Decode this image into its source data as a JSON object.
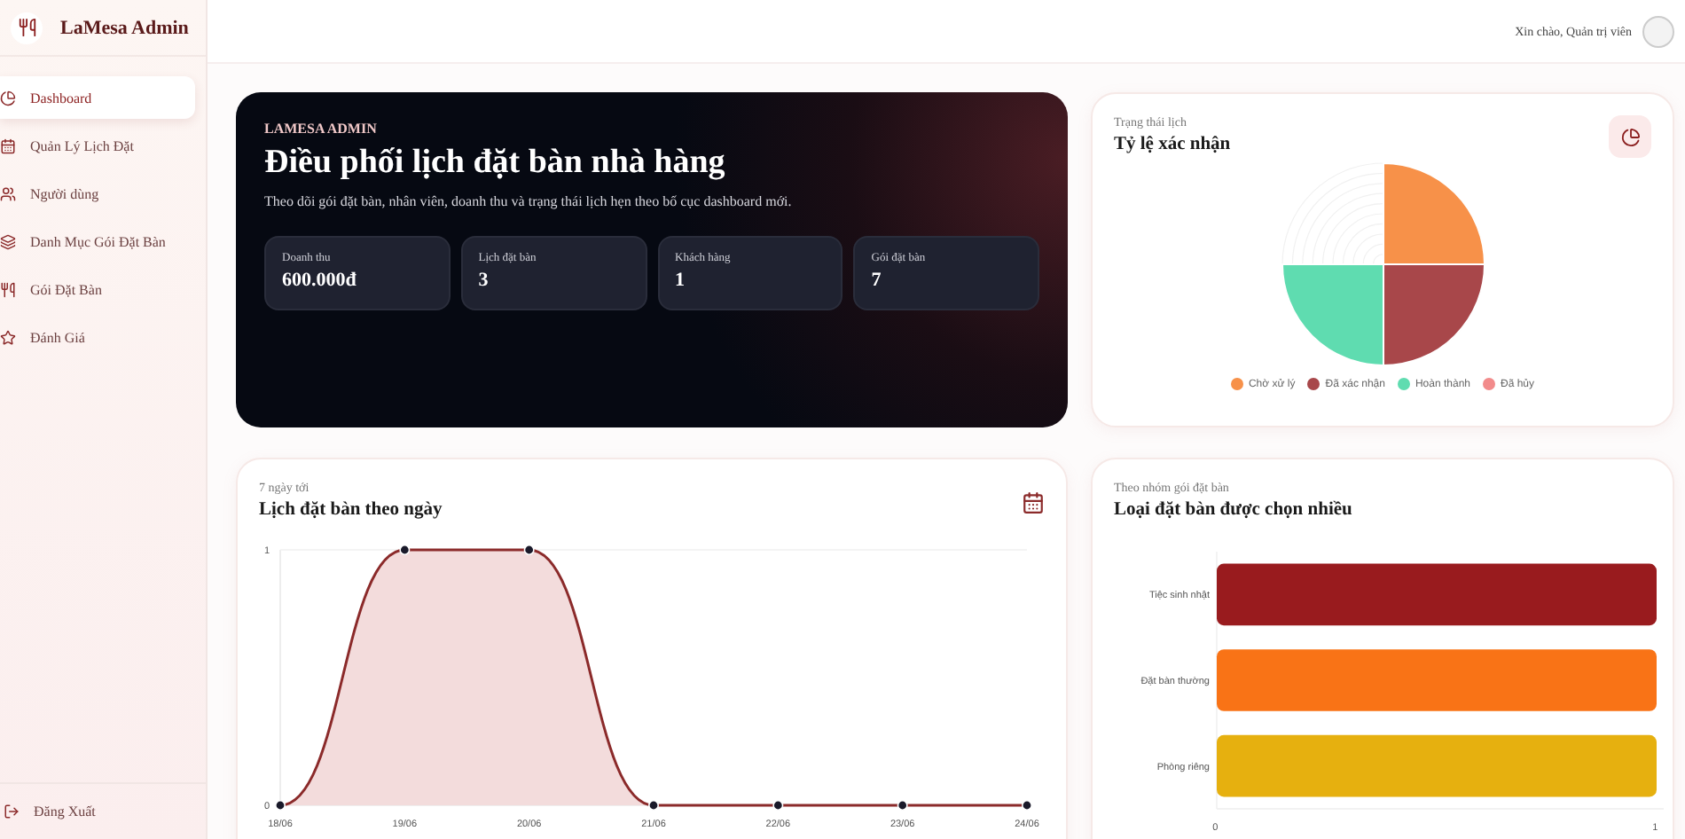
{
  "sidebar": {
    "brand": "LaMesa Admin",
    "items": [
      {
        "label": "Dashboard",
        "selected": true
      },
      {
        "label": "Quản Lý Lịch Đặt",
        "selected": false
      },
      {
        "label": "Người dùng",
        "selected": false
      },
      {
        "label": "Danh Mục Gói Đặt Bàn",
        "selected": false
      },
      {
        "label": "Gói Đặt Bàn",
        "selected": false
      },
      {
        "label": "Đánh Giá",
        "selected": false
      }
    ],
    "logout": "Đăng Xuất"
  },
  "topbar": {
    "greeting": "Xin chào, Quản trị viên"
  },
  "hero": {
    "eyebrow": "LAMESA ADMIN",
    "title": "Điều phối lịch đặt bàn nhà hàng",
    "subtitle": "Theo dõi gói đặt bàn, nhân viên, doanh thu và trạng thái lịch hẹn theo bố cục dashboard mới.",
    "stats": [
      {
        "label": "Doanh thu",
        "value": "600.000đ"
      },
      {
        "label": "Lịch đặt bàn",
        "value": "3"
      },
      {
        "label": "Khách hàng",
        "value": "1"
      },
      {
        "label": "Gói đặt bàn",
        "value": "7"
      }
    ]
  },
  "status_card": {
    "eyebrow": "Trạng thái lịch",
    "title": "Tỷ lệ xác nhận",
    "legend": [
      {
        "label": "Chờ xử lý",
        "color": "#f79149"
      },
      {
        "label": "Đã xác nhận",
        "color": "#a8474a"
      },
      {
        "label": "Hoàn thành",
        "color": "#5fdcb0"
      },
      {
        "label": "Đã hủy",
        "color": "#f28b8b"
      }
    ]
  },
  "daily_card": {
    "eyebrow": "7 ngày tới",
    "title": "Lịch đặt bàn theo ngày",
    "chart_data": {
      "type": "area",
      "categories": [
        "18/06",
        "19/06",
        "20/06",
        "21/06",
        "22/06",
        "23/06",
        "24/06"
      ],
      "values": [
        0,
        1,
        1,
        0,
        0,
        0,
        0
      ],
      "ylim": [
        0,
        1
      ],
      "yticks": [
        0,
        1
      ]
    }
  },
  "type_card": {
    "eyebrow": "Theo nhóm gói đặt bàn",
    "title": "Loại đặt bàn được chọn nhiều",
    "chart_data": {
      "type": "bar",
      "orientation": "horizontal",
      "categories": [
        "Tiệc sinh nhật",
        "Đặt bàn thường",
        "Phòng riêng"
      ],
      "values": [
        1,
        1,
        1
      ],
      "colors": [
        "#991b1e",
        "#f97316",
        "#e6b00f"
      ],
      "xlim": [
        0,
        1
      ],
      "xticks": [
        0,
        1
      ]
    }
  }
}
